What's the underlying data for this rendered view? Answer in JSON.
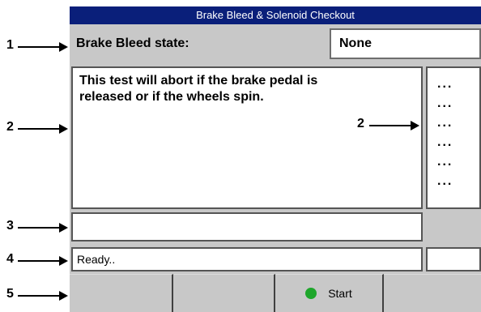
{
  "window": {
    "title": "Brake Bleed & Solenoid Checkout"
  },
  "state": {
    "label": "Brake Bleed state:",
    "value": "None"
  },
  "message": {
    "line1": "This test will abort if the brake pedal is",
    "line2": "released or if the wheels spin."
  },
  "side_list": {
    "items": [
      "...",
      "...",
      "...",
      "...",
      "...",
      "..."
    ]
  },
  "input": {
    "value": ""
  },
  "status": {
    "text": "Ready..",
    "secondary": ""
  },
  "buttons": [
    {
      "label": ""
    },
    {
      "label": ""
    },
    {
      "label": "Start",
      "indicator_color": "#1ea62b"
    },
    {
      "label": ""
    }
  ],
  "callouts": {
    "c1": "1",
    "c2a": "2",
    "c2b": "2",
    "c3": "3",
    "c4": "4",
    "c5": "5"
  },
  "colors": {
    "titlebar_bg": "#0a1f7a",
    "panel_bg": "#c8c8c8"
  }
}
